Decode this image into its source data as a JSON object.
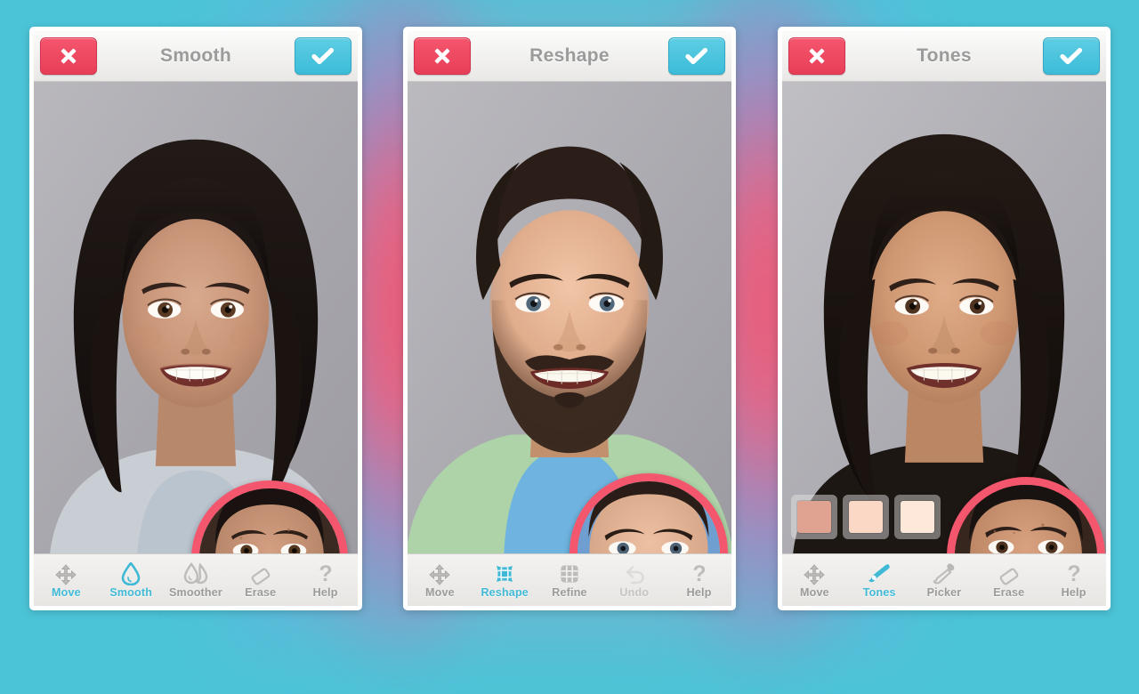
{
  "theme": {
    "background": "#4cc4d8",
    "glow": "#f4566d",
    "accent": "#3fb9d6",
    "cancel_red": "#ee4a63",
    "confirm_blue": "#49c3dc",
    "label_gray": "#9a9a9a",
    "magnifier_ring": "#f4566d"
  },
  "panels": [
    {
      "id": "smooth",
      "header": {
        "title": "Smooth",
        "cancel_label": "Cancel",
        "cancel_icon": "close-x-icon",
        "confirm_label": "Done",
        "confirm_icon": "checkmark-icon"
      },
      "photo": {
        "subject": "woman-portrait-smoothed",
        "background_color": "#a9a8ad"
      },
      "magnifier": {
        "label": "before-preview-loupe",
        "ring_color": "#f4566d"
      },
      "swatches": [],
      "tools": [
        {
          "label": "Move",
          "icon": "move-arrows-icon",
          "state": "normal"
        },
        {
          "label": "Smooth",
          "icon": "droplet-icon",
          "state": "active"
        },
        {
          "label": "Smoother",
          "icon": "double-droplet-icon",
          "state": "normal"
        },
        {
          "label": "Erase",
          "icon": "eraser-icon",
          "state": "normal"
        },
        {
          "label": "Help",
          "icon": "question-mark-icon",
          "state": "normal"
        }
      ]
    },
    {
      "id": "reshape",
      "header": {
        "title": "Reshape",
        "cancel_label": "Cancel",
        "cancel_icon": "close-x-icon",
        "confirm_label": "Done",
        "confirm_icon": "checkmark-icon"
      },
      "photo": {
        "subject": "man-portrait-reshaped",
        "background_color": "#a9a8ad"
      },
      "magnifier": {
        "label": "before-preview-loupe",
        "ring_color": "#f4566d"
      },
      "swatches": [],
      "tools": [
        {
          "label": "Move",
          "icon": "move-arrows-icon",
          "state": "normal"
        },
        {
          "label": "Reshape",
          "icon": "warp-grid-icon",
          "state": "active"
        },
        {
          "label": "Refine",
          "icon": "refine-grid-icon",
          "state": "normal"
        },
        {
          "label": "Undo",
          "icon": "undo-icon",
          "state": "disabled"
        },
        {
          "label": "Help",
          "icon": "question-mark-icon",
          "state": "normal"
        }
      ]
    },
    {
      "id": "tones",
      "header": {
        "title": "Tones",
        "cancel_label": "Cancel",
        "cancel_icon": "close-x-icon",
        "confirm_label": "Done",
        "confirm_icon": "checkmark-icon"
      },
      "photo": {
        "subject": "woman-portrait-toned",
        "background_color": "#a9a8ad"
      },
      "magnifier": {
        "label": "before-preview-loupe",
        "ring_color": "#f4566d"
      },
      "swatches": [
        {
          "name": "tone-swatch-1",
          "color": "#e0a391",
          "selected": true
        },
        {
          "name": "tone-swatch-2",
          "color": "#fbd7c6",
          "selected": false
        },
        {
          "name": "tone-swatch-3",
          "color": "#fde8d9",
          "selected": false
        }
      ],
      "tools": [
        {
          "label": "Move",
          "icon": "move-arrows-icon",
          "state": "normal"
        },
        {
          "label": "Tones",
          "icon": "brush-icon",
          "state": "active"
        },
        {
          "label": "Picker",
          "icon": "eyedropper-icon",
          "state": "normal"
        },
        {
          "label": "Erase",
          "icon": "eraser-icon",
          "state": "normal"
        },
        {
          "label": "Help",
          "icon": "question-mark-icon",
          "state": "normal"
        }
      ]
    }
  ]
}
